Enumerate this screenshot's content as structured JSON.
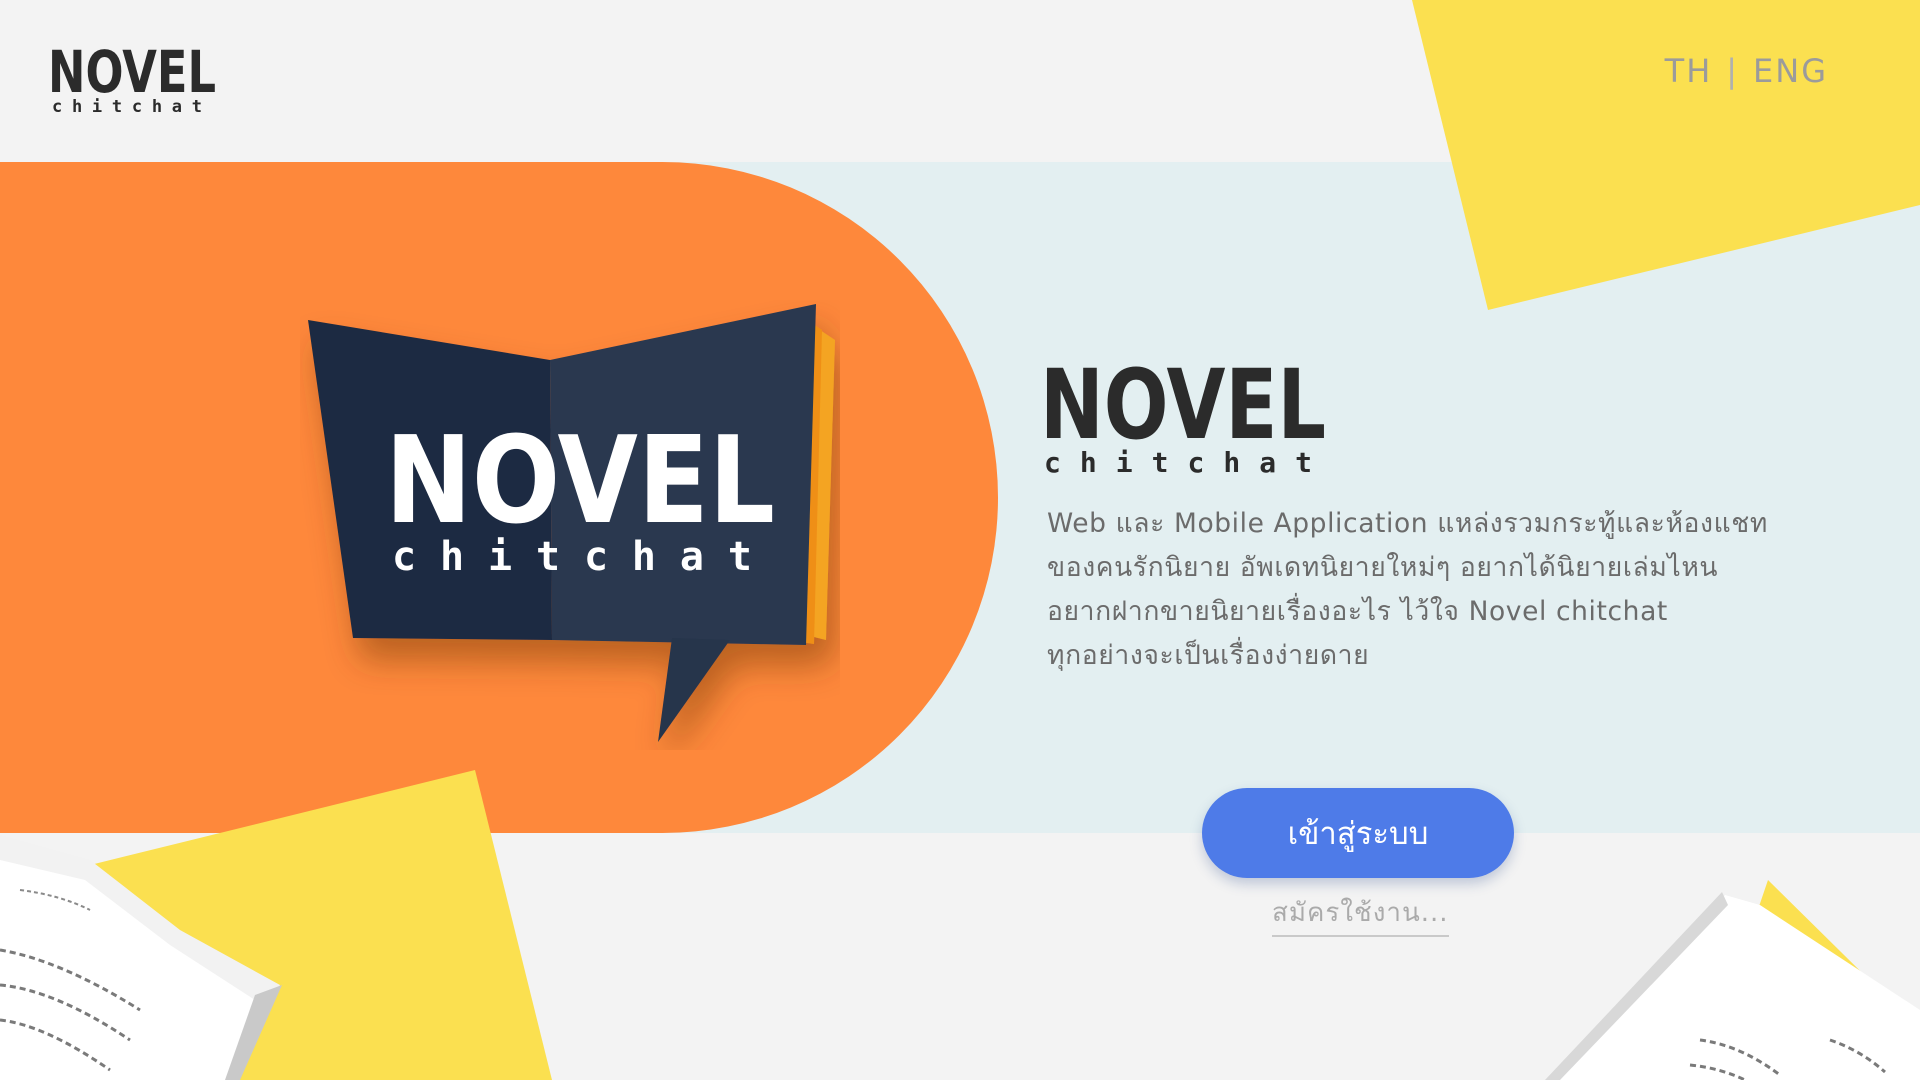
{
  "header": {
    "logo": {
      "title": "NOVEL",
      "subtitle": "chitchat"
    },
    "language": {
      "th": "TH",
      "separator": "|",
      "en": "ENG"
    }
  },
  "hero": {
    "book_logo": {
      "title": "NOVEL",
      "subtitle": "chitchat"
    },
    "right_logo": {
      "title": "NOVEL",
      "subtitle": "chitchat"
    },
    "description_lines": [
      "Web และ Mobile Application แหล่งรวมกระทู้และห้องแชท",
      "ของคนรักนิยาย  อัพเดทนิยายใหม่ๆ อยากได้นิยายเล่มไหน",
      "อยากฝากขายนิยายเรื่องอะไร ไว้ใจ Novel chitchat",
      "ทุกอย่างจะเป็นเรื่องง่ายดาย"
    ],
    "login_label": "เข้าสู่ระบบ",
    "signup_label": "สมัครใช้งาน..."
  },
  "colors": {
    "background": "#f3f3f3",
    "band": "#e3eff1",
    "orange": "#fe883b",
    "yellow": "#fbe050",
    "book_dark": "#223149",
    "button": "#4e7be8"
  }
}
